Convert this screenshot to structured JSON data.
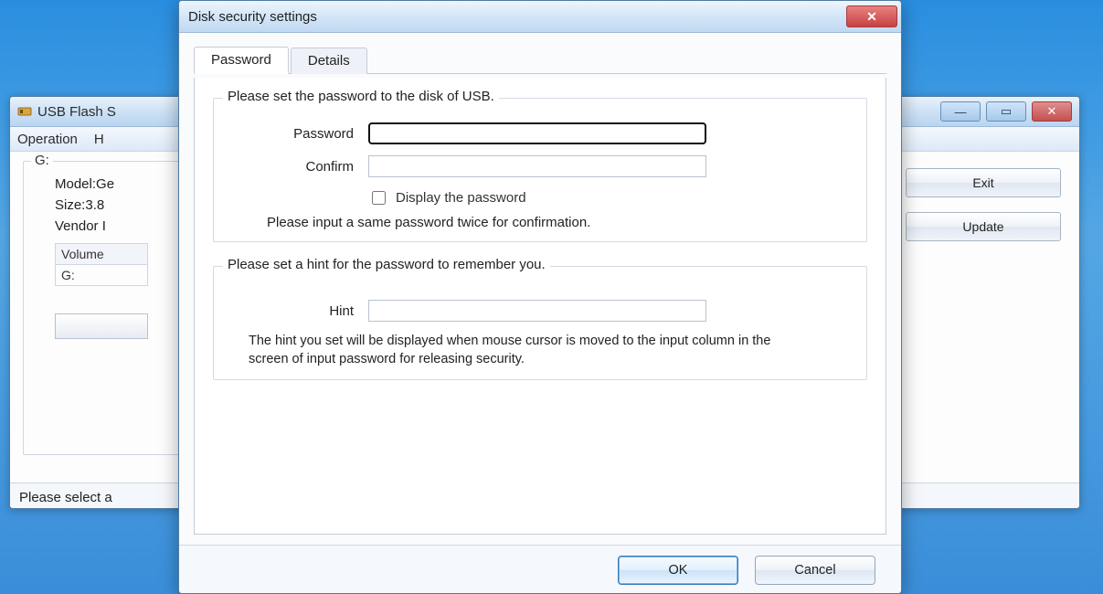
{
  "bg_window": {
    "title": "USB Flash S",
    "menu": {
      "operation": "Operation",
      "help_initial": "H"
    },
    "group_label": "G:",
    "info": {
      "model": "Model:Ge",
      "size": "Size:3.8",
      "vendor": "Vendor I"
    },
    "table": {
      "header": "Volume",
      "row1": "G:"
    },
    "buttons": {
      "exit": "Exit",
      "update": "Update"
    },
    "status": "Please select a"
  },
  "dialog": {
    "title": "Disk security settings",
    "tabs": {
      "password": "Password",
      "details": "Details"
    },
    "password_section": {
      "heading": "Please set the password to the disk of USB.",
      "password_label": "Password",
      "confirm_label": "Confirm",
      "display_pw_label": "Display the password",
      "confirm_note": "Please input a same password twice for confirmation."
    },
    "hint_section": {
      "heading": "Please set a hint for the password to remember you.",
      "hint_label": "Hint",
      "hint_note": "The hint you set will be displayed when mouse cursor is moved to the input column in the screen of input password for releasing security."
    },
    "buttons": {
      "ok": "OK",
      "cancel": "Cancel"
    }
  }
}
